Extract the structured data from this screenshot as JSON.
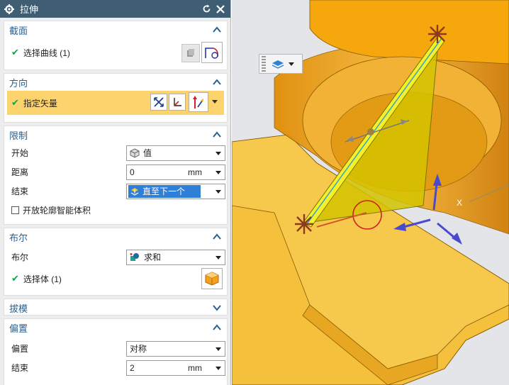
{
  "dialog": {
    "title": "拉伸",
    "sections": {
      "section_label": "截面",
      "direction_label": "方向",
      "limits_label": "限制",
      "boolean_label": "布尔",
      "draft_label": "拔模",
      "offset_label": "偏置"
    }
  },
  "section": {
    "select_curve": "选择曲线 (1)"
  },
  "direction": {
    "specify_vector": "指定矢量"
  },
  "limits": {
    "start_label": "开始",
    "start_value": "值",
    "distance_label": "距离",
    "distance_value": "0",
    "distance_unit": "mm",
    "end_label": "结束",
    "end_value": "直至下一个",
    "open_profile_label": "开放轮廓智能体积"
  },
  "boolean": {
    "boolean_label": "布尔",
    "boolean_value": "求和",
    "select_body": "选择体 (1)"
  },
  "offset": {
    "offset_label": "偏置",
    "offset_value": "对称",
    "end_label": "结束",
    "end_value": "2",
    "end_unit": "mm"
  },
  "viewport": {
    "axis_label": "X"
  },
  "colors": {
    "title_bar": "#3f5e74",
    "section_header": "#2a5f8f",
    "highlight_row": "#fcd36d",
    "selected_item": "#2f7fd8",
    "model_body": "#f0b429",
    "fin_face": "#d4c400"
  }
}
